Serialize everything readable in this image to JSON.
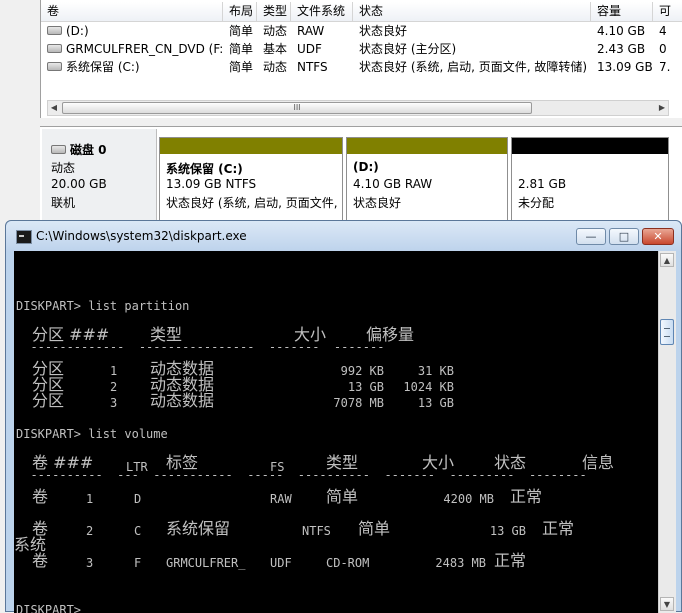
{
  "volume_table": {
    "headers": [
      "卷",
      "布局",
      "类型",
      "文件系统",
      "状态",
      "容量",
      "可"
    ],
    "rows": [
      {
        "name": "(D:)",
        "layout": "简单",
        "type": "动态",
        "fs": "RAW",
        "status": "状态良好",
        "capacity": "4.10 GB",
        "free": "4"
      },
      {
        "name": "GRMCULFRER_CN_DVD (F:)",
        "layout": "简单",
        "type": "基本",
        "fs": "UDF",
        "status": "状态良好 (主分区)",
        "capacity": "2.43 GB",
        "free": "0"
      },
      {
        "name": "系统保留 (C:)",
        "layout": "简单",
        "type": "动态",
        "fs": "NTFS",
        "status": "状态良好 (系统, 启动, 页面文件, 故障转储)",
        "capacity": "13.09 GB",
        "free": "7."
      }
    ],
    "scroll_grip": "III"
  },
  "disk": {
    "name": "磁盘 0",
    "type": "动态",
    "size": "20.00 GB",
    "state": "联机",
    "partitions": [
      {
        "title": "系统保留  (C:)",
        "line2": "13.09 GB NTFS",
        "line3": "状态良好 (系统, 启动, 页面文件,",
        "color": "#808000"
      },
      {
        "title": "(D:)",
        "line2": "4.10 GB RAW",
        "line3": "状态良好",
        "color": "#808000"
      },
      {
        "title": "",
        "line2": "2.81 GB",
        "line3": "未分配",
        "color": "#000000"
      }
    ]
  },
  "console": {
    "title": "C:\\Windows\\system32\\diskpart.exe",
    "buttons": {
      "minimize": "—",
      "restore": "□",
      "close": "✕"
    },
    "cmd1": "DISKPART> list partition",
    "part_headers": {
      "col1": "分区 ###",
      "col2": "类型",
      "col3": "大小",
      "col4": "偏移量"
    },
    "part_sep": "  -------------  ----------------  -------  -------",
    "partitions": [
      {
        "label": "分区",
        "num": "1",
        "type": "动态数据",
        "size": "992 KB",
        "offset": "31 KB"
      },
      {
        "label": "分区",
        "num": "2",
        "type": "动态数据",
        "size": "13 GB",
        "offset": "1024 KB"
      },
      {
        "label": "分区",
        "num": "3",
        "type": "动态数据",
        "size": "7078 MB",
        "offset": "13 GB"
      }
    ],
    "cmd2": "DISKPART> list volume",
    "vol_headers": {
      "col1": "卷 ###",
      "col2": "LTR",
      "col3": "标签",
      "col4": "FS",
      "col5": "类型",
      "col6": "大小",
      "col7": "状态",
      "col8": "信息"
    },
    "vol_sep": "  ----------  ---  -----------  -----  ----------  -------  ---------  --------",
    "volumes": [
      {
        "label": "卷",
        "num": "1",
        "ltr": "D",
        "name": "",
        "fs": "RAW",
        "type": "简单",
        "size": "4200 MB",
        "status": "正常",
        "info": ""
      },
      {
        "label": "卷",
        "num": "2",
        "ltr": "C",
        "name": "系统保留",
        "fs": "NTFS",
        "type": "简单",
        "size": "13 GB",
        "status": "正常",
        "info": "系统"
      },
      {
        "label": "卷",
        "num": "3",
        "ltr": "F",
        "name": "GRMCULFRER_",
        "fs": "UDF",
        "type": "CD-ROM",
        "size": "2483 MB",
        "status": "正常",
        "info": ""
      }
    ],
    "prompt": "DISKPART>"
  }
}
